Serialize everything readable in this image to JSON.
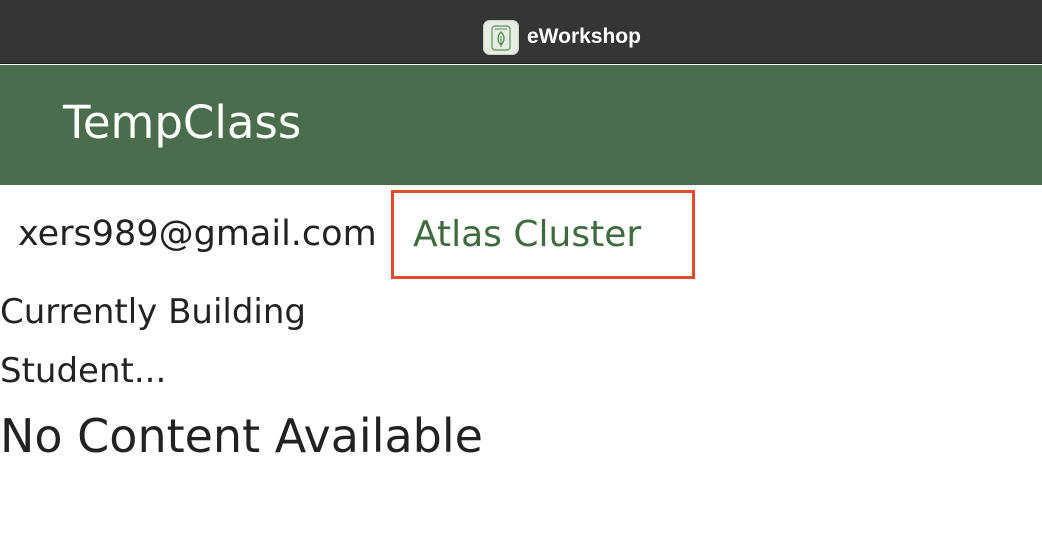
{
  "window": {
    "app_title": "eWorkshop",
    "app_icon": "leaf-icon"
  },
  "header": {
    "title": "TempClass",
    "background_color": "#4a6e4d"
  },
  "user": {
    "email": "xers989@gmail.com"
  },
  "cluster": {
    "label": "Atlas Cluster",
    "link_color": "#3f6a3d",
    "highlight_color": "#e04a2f"
  },
  "status": {
    "line1": "Currently Building",
    "line2": "Student..."
  },
  "content": {
    "empty_message": "No Content Available"
  }
}
